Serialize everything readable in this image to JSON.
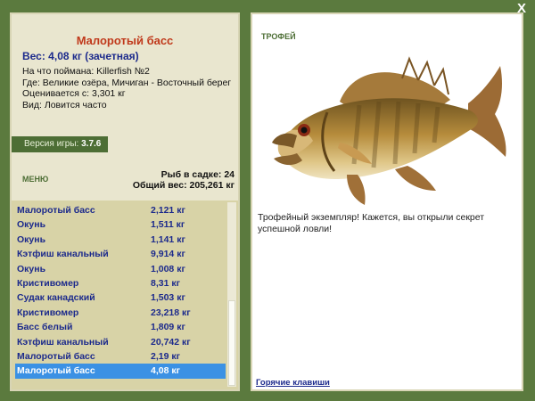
{
  "window": {
    "close_label": "X"
  },
  "fish": {
    "title": "Малоротый басс",
    "weight": "Вес: 4,08 кг (зачетная)",
    "info": [
      "На что поймана: Killerfish №2",
      "Где: Великие озёра, Мичиган - Восточный берег",
      "Оценивается с: 3,301 кг",
      "Вид: Ловится часто"
    ]
  },
  "version": {
    "label": "Версия игры:",
    "value": "3.7.6"
  },
  "menu_label": "МЕНЮ",
  "stats": {
    "count": "Рыб в садке: 24",
    "total": "Общий вес: 205,261 кг"
  },
  "catch_list": [
    {
      "name": "Малоротый басс",
      "weight": "2,121 кг"
    },
    {
      "name": "Окунь",
      "weight": "1,511 кг"
    },
    {
      "name": "Окунь",
      "weight": "1,141 кг"
    },
    {
      "name": "Кэтфиш канальный",
      "weight": "9,914 кг"
    },
    {
      "name": "Окунь",
      "weight": "1,008 кг"
    },
    {
      "name": "Кристивомер",
      "weight": "8,31 кг"
    },
    {
      "name": "Судак канадский",
      "weight": "1,503 кг"
    },
    {
      "name": "Кристивомер",
      "weight": "23,218 кг"
    },
    {
      "name": "Басс белый",
      "weight": "1,809 кг"
    },
    {
      "name": "Кэтфиш канальный",
      "weight": "20,742 кг"
    },
    {
      "name": "Малоротый басс",
      "weight": "2,19 кг"
    },
    {
      "name": "Малоротый басс",
      "weight": "4,08 кг"
    }
  ],
  "selected_index": 11,
  "trophy": {
    "label": "ТРОФЕЙ",
    "description": "Трофейный экземпляр! Кажется, вы открыли секрет успешной ловли!"
  },
  "hotkeys_label": "Горячие клавиши",
  "colors": {
    "background": "#5b7a3e",
    "panel": "#e9e6cf",
    "list": "#d8d3a7",
    "selection": "#3b91e4",
    "accent": "#1c2a8c",
    "title": "#c0391b"
  }
}
